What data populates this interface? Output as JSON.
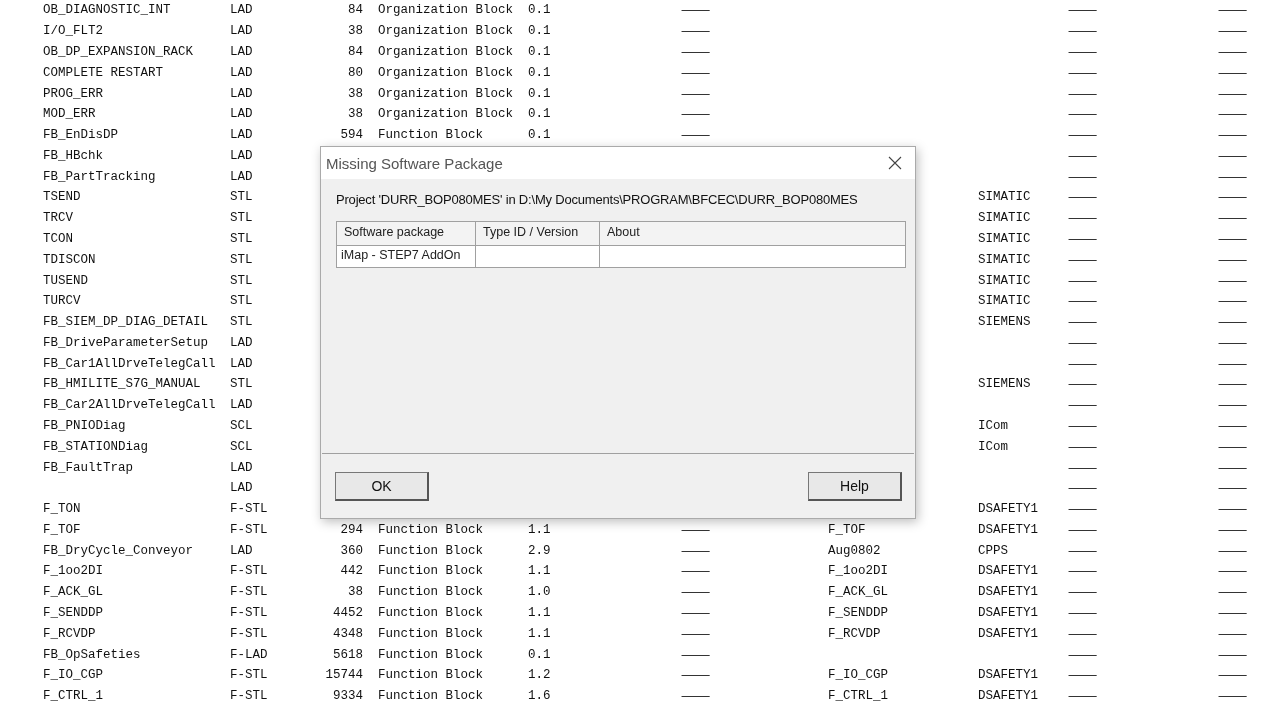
{
  "table": {
    "rows": [
      {
        "column_1": "OB_DIAGNOSTIC_INT",
        "column_2": "LAD",
        "column_3": "84",
        "column_4": "Organization Block",
        "column_5": "0.1",
        "column_6": "—",
        "column_9": "—",
        "column_10": "—"
      },
      {
        "column_1": "I/O_FLT2",
        "column_2": "LAD",
        "column_3": "38",
        "column_4": "Organization Block",
        "column_5": "0.1",
        "column_6": "—",
        "column_9": "—",
        "column_10": "—"
      },
      {
        "column_1": "OB_DP_EXPANSION_RACK",
        "column_2": "LAD",
        "column_3": "84",
        "column_4": "Organization Block",
        "column_5": "0.1",
        "column_6": "—",
        "column_9": "—",
        "column_10": "—"
      },
      {
        "column_1": "COMPLETE RESTART",
        "column_2": "LAD",
        "column_3": "80",
        "column_4": "Organization Block",
        "column_5": "0.1",
        "column_6": "—",
        "column_9": "—",
        "column_10": "—"
      },
      {
        "column_1": "PROG_ERR",
        "column_2": "LAD",
        "column_3": "38",
        "column_4": "Organization Block",
        "column_5": "0.1",
        "column_6": "—",
        "column_9": "—",
        "column_10": "—"
      },
      {
        "column_1": "MOD_ERR",
        "column_2": "LAD",
        "column_3": "38",
        "column_4": "Organization Block",
        "column_5": "0.1",
        "column_6": "—",
        "column_9": "—",
        "column_10": "—"
      },
      {
        "column_1": "FB_EnDisDP",
        "column_2": "LAD",
        "column_3": "594",
        "column_4": "Function Block",
        "column_5": "0.1",
        "column_6": "—",
        "column_9": "—",
        "column_10": "—"
      },
      {
        "column_1": "FB_HBchk",
        "column_2": "LAD",
        "column_9": "—",
        "column_10": "—"
      },
      {
        "column_1": "FB_PartTracking",
        "column_2": "LAD",
        "column_9": "—",
        "column_10": "—"
      },
      {
        "column_1": "TSEND",
        "column_2": "STL",
        "column_8": "SIMATIC",
        "column_9": "—",
        "column_10": "—"
      },
      {
        "column_1": "TRCV",
        "column_2": "STL",
        "column_8": "SIMATIC",
        "column_9": "—",
        "column_10": "—"
      },
      {
        "column_1": "TCON",
        "column_2": "STL",
        "column_8": "SIMATIC",
        "column_9": "—",
        "column_10": "—"
      },
      {
        "column_1": "TDISCON",
        "column_2": "STL",
        "column_8": "SIMATIC",
        "column_9": "—",
        "column_10": "—"
      },
      {
        "column_1": "TUSEND",
        "column_2": "STL",
        "column_8": "SIMATIC",
        "column_9": "—",
        "column_10": "—"
      },
      {
        "column_1": "TURCV",
        "column_2": "STL",
        "column_8": "SIMATIC",
        "column_9": "—",
        "column_10": "—"
      },
      {
        "column_1": "FB_SIEM_DP_DIAG_DETAIL",
        "column_2": "STL",
        "column_8": "SIEMENS",
        "column_9": "—",
        "column_10": "—"
      },
      {
        "column_1": "FB_DriveParameterSetup",
        "column_2": "LAD",
        "column_9": "—",
        "column_10": "—"
      },
      {
        "column_1": "FB_Car1AllDrveTelegCall",
        "column_2": "LAD",
        "column_9": "—",
        "column_10": "—"
      },
      {
        "column_1": "FB_HMILITE_S7G_MANUAL",
        "column_2": "STL",
        "column_8": "SIEMENS",
        "column_9": "—",
        "column_10": "—"
      },
      {
        "column_1": "FB_Car2AllDrveTelegCall",
        "column_2": "LAD",
        "column_9": "—",
        "column_10": "—"
      },
      {
        "column_1": "FB_PNIODiag",
        "column_2": "SCL",
        "column_8": "ICom",
        "column_9": "—",
        "column_10": "—"
      },
      {
        "column_1": "FB_STATIONDiag",
        "column_2": "SCL",
        "column_8": "ICom",
        "column_9": "—",
        "column_10": "—"
      },
      {
        "column_1": "FB_FaultTrap",
        "column_2": "LAD",
        "column_9": "—",
        "column_10": "—"
      },
      {
        "column_2": "LAD",
        "column_9": "—",
        "column_10": "—"
      },
      {
        "column_1": "F_TON",
        "column_2": "F-STL",
        "column_8": "DSAFETY1",
        "column_9": "—",
        "column_10": "—"
      },
      {
        "column_1": "F_TOF",
        "column_2": "F-STL",
        "column_3": "294",
        "column_4": "Function Block",
        "column_5": "1.1",
        "column_6": "—",
        "column_7": "F_TOF",
        "column_8": "DSAFETY1",
        "column_9": "—",
        "column_10": "—"
      },
      {
        "column_1": "FB_DryCycle_Conveyor",
        "column_2": "LAD",
        "column_3": "360",
        "column_4": "Function Block",
        "column_5": "2.9",
        "column_6": "—",
        "column_7": "Aug0802",
        "column_8": "CPPS",
        "column_9": "—",
        "column_10": "—"
      },
      {
        "column_1": "F_1oo2DI",
        "column_2": "F-STL",
        "column_3": "442",
        "column_4": "Function Block",
        "column_5": "1.1",
        "column_6": "—",
        "column_7": "F_1oo2DI",
        "column_8": "DSAFETY1",
        "column_9": "—",
        "column_10": "—"
      },
      {
        "column_1": "F_ACK_GL",
        "column_2": "F-STL",
        "column_3": "38",
        "column_4": "Function Block",
        "column_5": "1.0",
        "column_6": "—",
        "column_7": "F_ACK_GL",
        "column_8": "DSAFETY1",
        "column_9": "—",
        "column_10": "—"
      },
      {
        "column_1": "F_SENDDP",
        "column_2": "F-STL",
        "column_3": "4452",
        "column_4": "Function Block",
        "column_5": "1.1",
        "column_6": "—",
        "column_7": "F_SENDDP",
        "column_8": "DSAFETY1",
        "column_9": "—",
        "column_10": "—"
      },
      {
        "column_1": "F_RCVDP",
        "column_2": "F-STL",
        "column_3": "4348",
        "column_4": "Function Block",
        "column_5": "1.1",
        "column_6": "—",
        "column_7": "F_RCVDP",
        "column_8": "DSAFETY1",
        "column_9": "—",
        "column_10": "—"
      },
      {
        "column_1": "FB_OpSafeties",
        "column_2": "F-LAD",
        "column_3": "5618",
        "column_4": "Function Block",
        "column_5": "0.1",
        "column_6": "—",
        "column_9": "—",
        "column_10": "—"
      },
      {
        "column_1": "F_IO_CGP",
        "column_2": "F-STL",
        "column_3": "15744",
        "column_4": "Function Block",
        "column_5": "1.2",
        "column_6": "—",
        "column_7": "F_IO_CGP",
        "column_8": "DSAFETY1",
        "column_9": "—",
        "column_10": "—"
      },
      {
        "column_1": "F_CTRL_1",
        "column_2": "F-STL",
        "column_3": "9334",
        "column_4": "Function Block",
        "column_5": "1.6",
        "column_6": "—",
        "column_7": "F_CTRL_1",
        "column_8": "DSAFETY1",
        "column_9": "—",
        "column_10": "—"
      }
    ]
  },
  "dialog": {
    "title": "Missing Software Package",
    "message": "Project 'DURR_BOP080MES' in D:\\My Documents\\PROGRAM\\BFCEC\\DURR_BOP080MES",
    "table": {
      "columns": [
        "Software package",
        "Type ID / Version",
        "About"
      ],
      "rows": [
        [
          "iMap - STEP7 AddOn"
        ]
      ]
    },
    "buttons": [
      "OK",
      "Help"
    ]
  }
}
